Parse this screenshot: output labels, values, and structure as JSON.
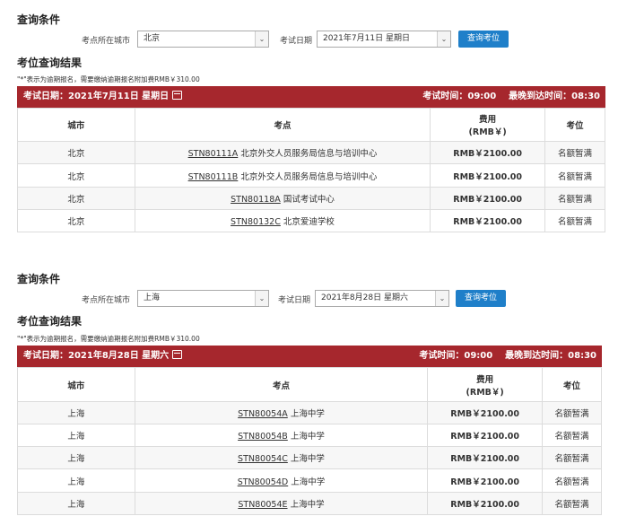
{
  "sections": [
    {
      "query_title": "查询条件",
      "city_label": "考点所在城市",
      "city_value": "北京",
      "date_label": "考试日期",
      "date_value": "2021年7月11日 星期日",
      "query_button": "查询考位",
      "result_title": "考位查询结果",
      "note": "\"*\"表示为逾期报名，需要缴纳逾期报名附加费RMB￥310.00",
      "exam_date": "考试日期：2021年7月11日 星期日",
      "exam_time": "考试时间：09:00",
      "latest_arrival": "最晚到达时间：08:30",
      "headers": {
        "city": "城市",
        "center": "考点",
        "fee_line1": "费用",
        "fee_line2": "(RMB￥)",
        "seat": "考位"
      },
      "rows": [
        {
          "city": "北京",
          "code": "STN80111A",
          "name": "北京外交人员服务局信息与培训中心",
          "fee": "RMB￥2100.00",
          "seat": "名额暂满"
        },
        {
          "city": "北京",
          "code": "STN80111B",
          "name": "北京外交人员服务局信息与培训中心",
          "fee": "RMB￥2100.00",
          "seat": "名额暂满"
        },
        {
          "city": "北京",
          "code": "STN80118A",
          "name": "国试考试中心",
          "fee": "RMB￥2100.00",
          "seat": "名额暂满"
        },
        {
          "city": "北京",
          "code": "STN80132C",
          "name": "北京爱迪学校",
          "fee": "RMB￥2100.00",
          "seat": "名额暂满"
        }
      ]
    },
    {
      "query_title": "查询条件",
      "city_label": "考点所在城市",
      "city_value": "上海",
      "date_label": "考试日期",
      "date_value": "2021年8月28日 星期六",
      "query_button": "查询考位",
      "result_title": "考位查询结果",
      "note": "\"*\"表示为逾期报名，需要缴纳逾期报名附加费RMB￥310.00",
      "exam_date": "考试日期：2021年8月28日 星期六",
      "exam_time": "考试时间：09:00",
      "latest_arrival": "最晚到达时间：08:30",
      "headers": {
        "city": "城市",
        "center": "考点",
        "fee_line1": "费用",
        "fee_line2": "(RMB￥)",
        "seat": "考位"
      },
      "rows": [
        {
          "city": "上海",
          "code": "STN80054A",
          "name": "上海中学",
          "fee": "RMB￥2100.00",
          "seat": "名额暂满"
        },
        {
          "city": "上海",
          "code": "STN80054B",
          "name": "上海中学",
          "fee": "RMB￥2100.00",
          "seat": "名额暂满"
        },
        {
          "city": "上海",
          "code": "STN80054C",
          "name": "上海中学",
          "fee": "RMB￥2100.00",
          "seat": "名额暂满"
        },
        {
          "city": "上海",
          "code": "STN80054D",
          "name": "上海中学",
          "fee": "RMB￥2100.00",
          "seat": "名额暂满"
        },
        {
          "city": "上海",
          "code": "STN80054E",
          "name": "上海中学",
          "fee": "RMB￥2100.00",
          "seat": "名额暂满"
        }
      ]
    }
  ]
}
